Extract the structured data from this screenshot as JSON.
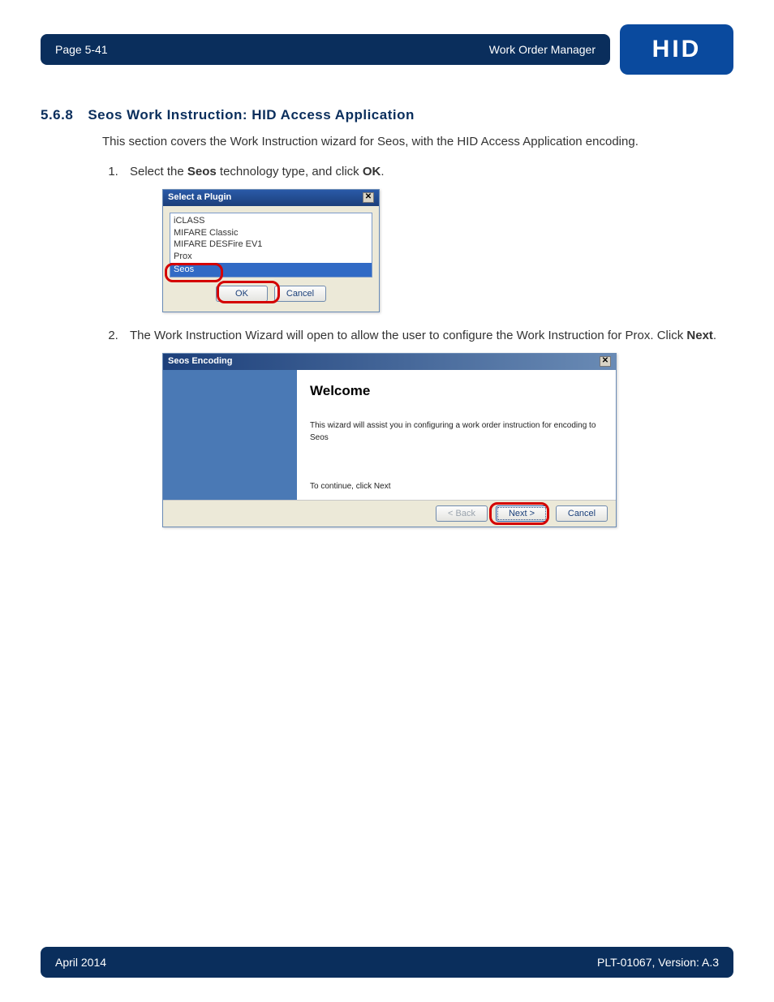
{
  "header": {
    "page_label": "Page 5-41",
    "doc_title": "Work Order Manager",
    "logo_text": "HID"
  },
  "section": {
    "number": "5.6.8",
    "title": "Seos Work Instruction: HID Access Application",
    "intro": "This section covers the Work Instruction wizard for Seos, with the HID Access Application encoding."
  },
  "steps": {
    "s1_prefix": "Select the ",
    "s1_bold1": "Seos",
    "s1_mid": " technology type, and click ",
    "s1_bold2": "OK",
    "s1_suffix": ".",
    "s2_prefix": "The Work Instruction Wizard will open to allow the user to configure the Work Instruction for Prox. Click ",
    "s2_bold": "Next",
    "s2_suffix": "."
  },
  "dialog1": {
    "title": "Select a Plugin",
    "items": [
      "iCLASS",
      "MIFARE Classic",
      "MIFARE DESFire EV1",
      "Prox",
      "Seos"
    ],
    "ok": "OK",
    "cancel": "Cancel"
  },
  "dialog2": {
    "title": "Seos Encoding",
    "heading": "Welcome",
    "desc": "This wizard will assist you in configuring a work order instruction for encoding to Seos",
    "continue": "To continue, click Next",
    "back": "< Back",
    "next": "Next >",
    "cancel": "Cancel"
  },
  "footer": {
    "date": "April 2014",
    "version": "PLT-01067, Version: A.3"
  }
}
